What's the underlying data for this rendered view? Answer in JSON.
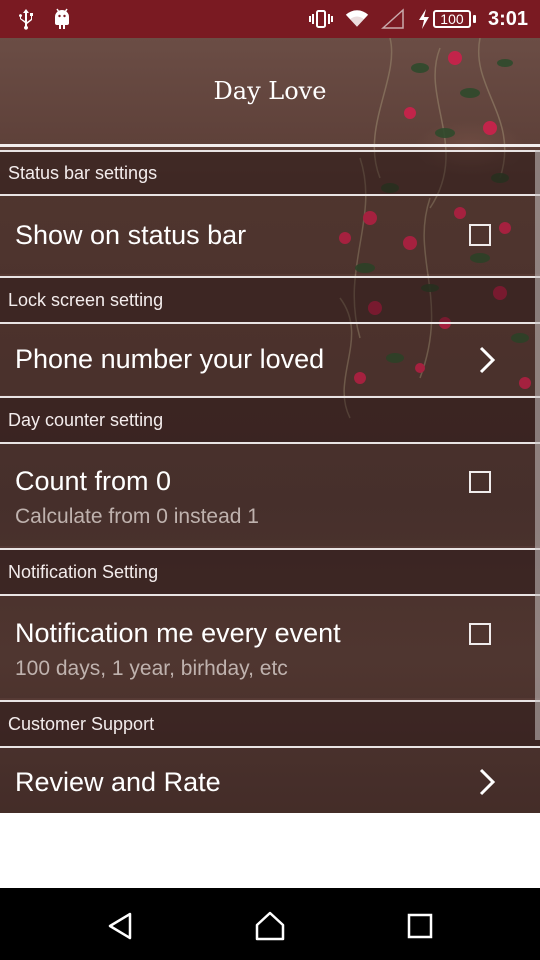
{
  "status_bar": {
    "time": "3:01",
    "battery": "100",
    "left_icons": [
      "usb-icon",
      "android-icon"
    ],
    "right_icons": [
      "vibrate-icon",
      "wifi-icon",
      "signal-icon",
      "charging-icon"
    ],
    "color": "#7a1a22"
  },
  "app": {
    "title": "Day Love"
  },
  "sections": {
    "status_bar": {
      "header": "Status bar settings",
      "item_title": "Show on status bar"
    },
    "lock_screen": {
      "header": "Lock screen setting",
      "item_title": "Phone number your loved"
    },
    "day_counter": {
      "header": "Day counter setting",
      "item_title": "Count from 0",
      "item_subtitle": "Calculate from 0 instead 1"
    },
    "notification": {
      "header": "Notification Setting",
      "item_title": "Notification me every event",
      "item_subtitle": "100 days, 1 year, birhday, etc"
    },
    "support": {
      "header": "Customer Support",
      "item_title": "Review and Rate"
    }
  },
  "nav_bar": {
    "buttons": [
      "back-icon",
      "home-icon",
      "recents-icon"
    ]
  }
}
